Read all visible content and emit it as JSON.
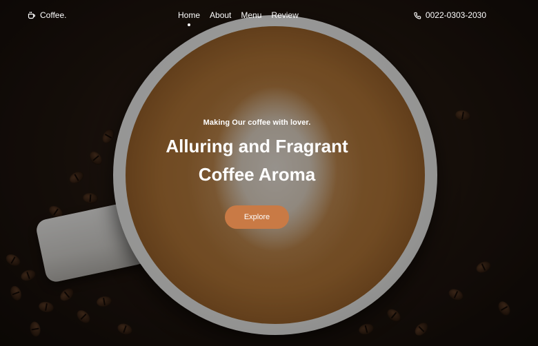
{
  "nav": {
    "brand": "Coffee.",
    "brand_icon": "coffee-cup-icon",
    "links": [
      "Home",
      "About",
      "Menu",
      "Review"
    ],
    "active_link": "Home",
    "phone_icon": "phone-icon",
    "phone": "0022-0303-2030"
  },
  "hero": {
    "tagline": "Making Our coffee with lover.",
    "headline_line1": "Alluring and Fragrant",
    "headline_line2": "Coffee Aroma",
    "cta_label": "Explore"
  },
  "colors": {
    "accent": "#c97a45",
    "text": "#ffffff"
  }
}
